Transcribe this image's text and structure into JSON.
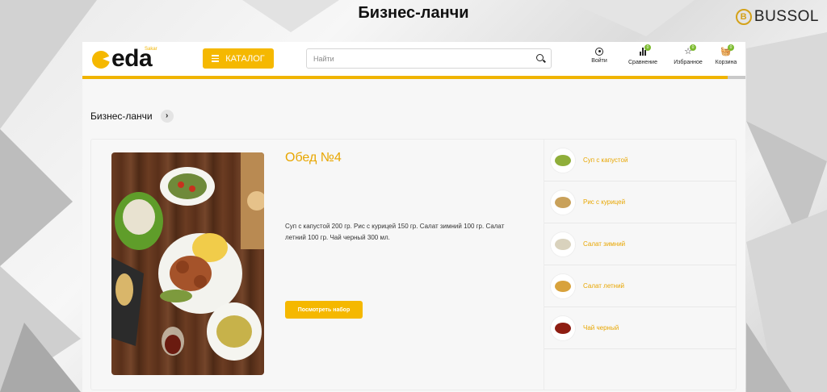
{
  "slide": {
    "title": "Бизнес-ланчи",
    "brand": "BUSSOL",
    "brand_mark": "B"
  },
  "header": {
    "logo_text": "eda",
    "logo_small": "Sakar",
    "catalog_label": "КАТАЛОГ",
    "search_placeholder": "Найти",
    "actions": {
      "login": "Войти",
      "compare": "Сравнение",
      "compare_count": "0",
      "favorites": "Избранное",
      "favorites_count": "0",
      "cart": "Корзина",
      "cart_count": "0"
    }
  },
  "breadcrumb": {
    "label": "Бизнес-ланчи",
    "arrow": "›"
  },
  "product": {
    "title": "Обед №4",
    "description": "Суп с капустой 200 гр. Рис с курицей 150 гр. Салат зимний 100 гр. Салат летний 100 гр. Чай черный 300 мл.",
    "button_label": "Посмотреть набор"
  },
  "items": [
    {
      "label": "Суп с капустой",
      "icon": "soup-bowl-icon",
      "color": "#8fae3a"
    },
    {
      "label": "Рис с курицей",
      "icon": "rice-plate-icon",
      "color": "#c9a15a"
    },
    {
      "label": "Салат зимний",
      "icon": "salad-bowl-icon",
      "color": "#d9d2bd"
    },
    {
      "label": "Салат летний",
      "icon": "salad-plate-icon",
      "color": "#d8a23c"
    },
    {
      "label": "Чай черный",
      "icon": "tea-cup-icon",
      "color": "#8e1d12"
    }
  ],
  "colors": {
    "accent": "#f5b800",
    "accent_text": "#e8a600",
    "badge": "#7cbb2e"
  }
}
